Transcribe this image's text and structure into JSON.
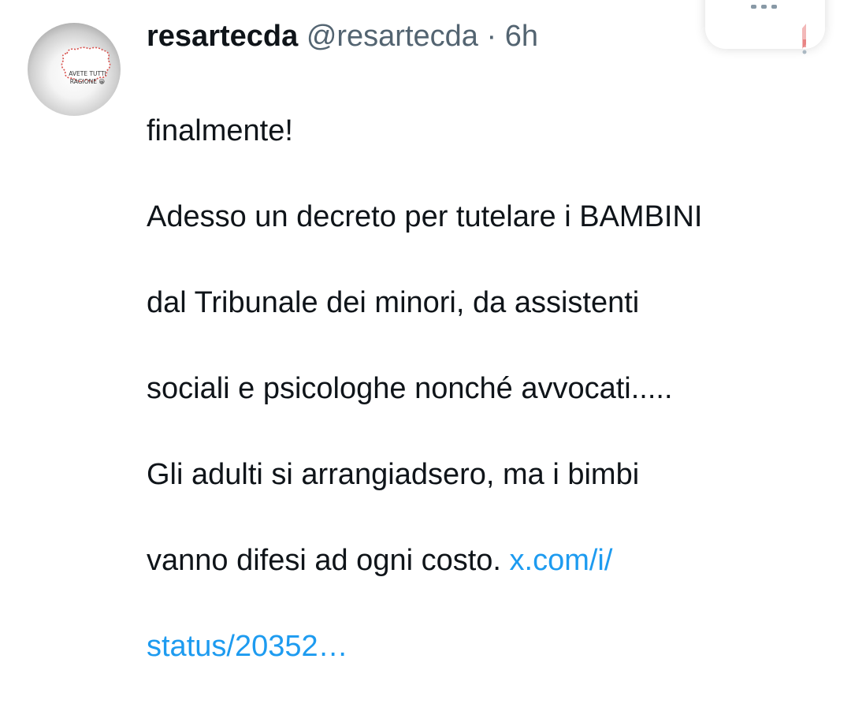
{
  "tweet": {
    "author_name": "resartecda",
    "handle": "@resartecda",
    "separator": "·",
    "time": "6h",
    "avatar": {
      "line1": "AVETE TUTTI",
      "line2": "RAGIONE 😀"
    },
    "text_lines": [
      "finalmente!",
      "Adesso un decreto per tutelare i BAMBINI",
      "dal Tribunale dei  minori, da assistenti",
      "sociali e psicologhe nonché avvocati.....",
      "Gli adulti si arrangiadsero, ma i bimbi"
    ],
    "last_line_text": "vanno difesi ad ogni costo. ",
    "link_part1": "x.com/i/",
    "link_part2": "status/20352…"
  },
  "colors": {
    "text": "#0f1419",
    "secondary": "#536471",
    "link": "#1d9bf0"
  }
}
